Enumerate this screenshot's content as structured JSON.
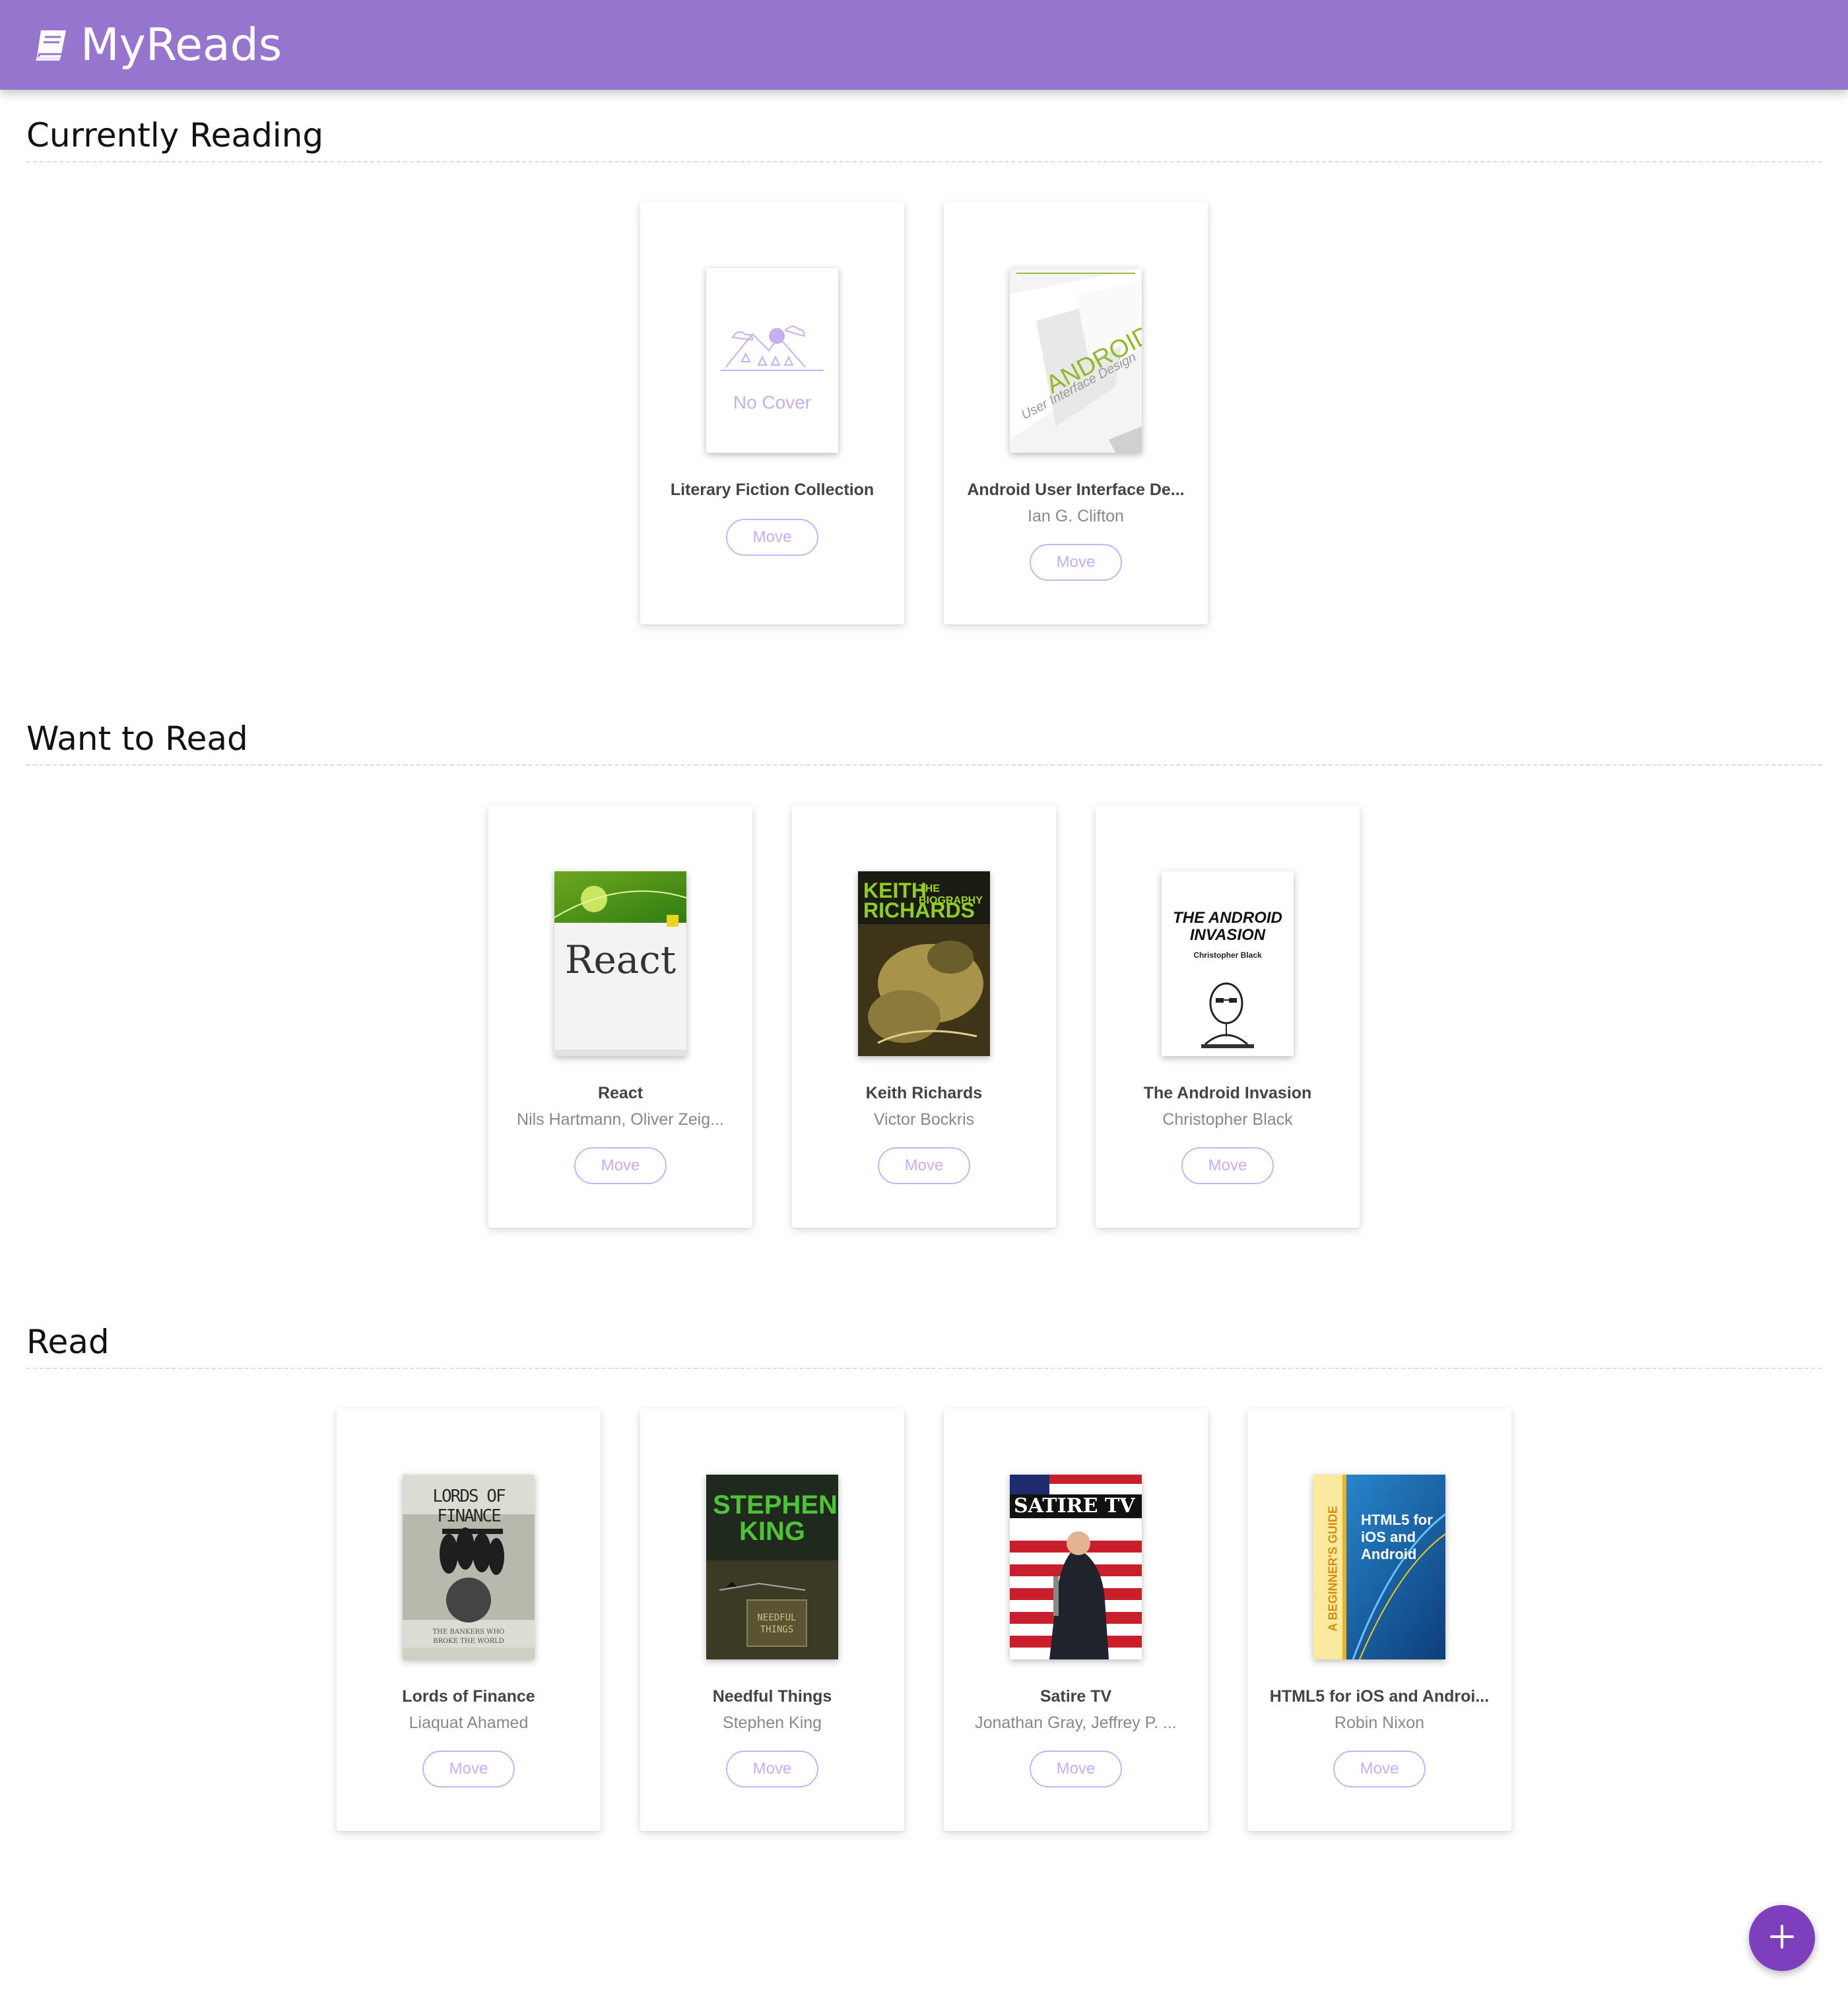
{
  "app": {
    "title": "MyReads",
    "icon": "book-icon",
    "accent": "#9575cd"
  },
  "shelves": [
    {
      "title": "Currently Reading",
      "books": [
        {
          "title": "Literary Fiction Collection",
          "author": "",
          "cover": "no-cover",
          "cover_text": "No Cover",
          "move_label": "Move"
        },
        {
          "title": "Android User Interface De...",
          "author": "Ian G. Clifton",
          "cover": "android-ui",
          "cover_text": "ANDROID",
          "cover_subtext": "User Interface Design",
          "move_label": "Move"
        }
      ]
    },
    {
      "title": "Want to Read",
      "books": [
        {
          "title": "React",
          "author": "Nils Hartmann, Oliver Zeig...",
          "cover": "react",
          "cover_text": "React",
          "move_label": "Move"
        },
        {
          "title": "Keith Richards",
          "author": "Victor Bockris",
          "cover": "keith",
          "cover_text": "KEITH RICHARDS",
          "cover_subtext": "THE BIOGRAPHY",
          "move_label": "Move"
        },
        {
          "title": "The Android Invasion",
          "author": "Christopher Black",
          "cover": "android-invasion",
          "cover_text": "THE ANDROID INVASION",
          "cover_subtext": "Christopher Black",
          "move_label": "Move"
        }
      ]
    },
    {
      "title": "Read",
      "books": [
        {
          "title": "Lords of Finance",
          "author": "Liaquat Ahamed",
          "cover": "lords",
          "cover_text": "LORDS OF FINANCE",
          "cover_subtext": "THE BANKERS WHO BROKE THE WORLD",
          "move_label": "Move"
        },
        {
          "title": "Needful Things",
          "author": "Stephen King",
          "cover": "needful",
          "cover_text": "STEPHEN KING",
          "cover_subtext": "NEEDFUL THINGS",
          "move_label": "Move"
        },
        {
          "title": "Satire TV",
          "author": "Jonathan Gray, Jeffrey P. ...",
          "cover": "satire",
          "cover_text": "SATIRE TV",
          "move_label": "Move"
        },
        {
          "title": "HTML5 for iOS and Androi...",
          "author": "Robin Nixon",
          "cover": "html5",
          "cover_text": "HTML5 for iOS and Android",
          "cover_subtext": "A BEGINNER'S GUIDE",
          "move_label": "Move"
        }
      ]
    }
  ],
  "fab": {
    "icon": "plus-icon"
  }
}
